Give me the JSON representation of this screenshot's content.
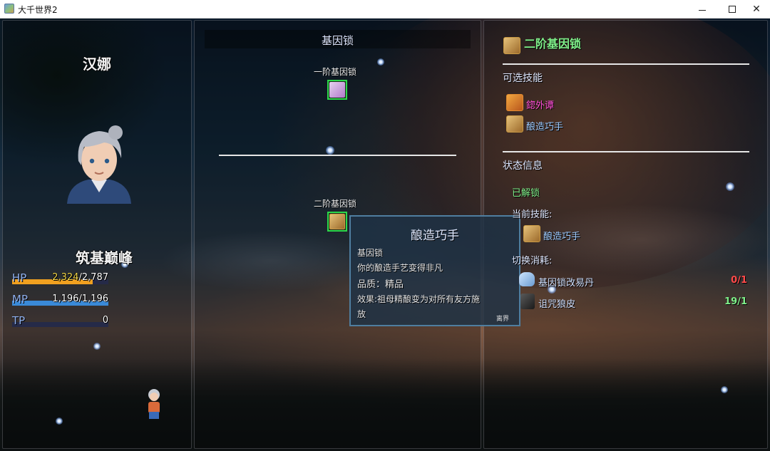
{
  "window": {
    "title": "大千世界2"
  },
  "character": {
    "name": "汉娜",
    "realm": "筑基巅峰",
    "stats": [
      {
        "label": "HP",
        "current": "2,324",
        "max": "2,787",
        "fraction": 0.834,
        "color": "#f0a020",
        "current_color": "low"
      },
      {
        "label": "MP",
        "current": "1,196",
        "max": "1,196",
        "fraction": 1.0,
        "color": "#3a8ad8",
        "current_color": "normal"
      },
      {
        "label": "TP",
        "value": "0",
        "fraction": 0.0,
        "color": "#3aa060"
      }
    ]
  },
  "gene_lock": {
    "title": "基因锁",
    "tiers": [
      {
        "label": "一阶基因锁",
        "icon": "tier1-gene-icon"
      },
      {
        "label": "二阶基因锁",
        "icon": "brewing-skill-icon"
      }
    ]
  },
  "tooltip": {
    "title": "酿造巧手",
    "category": "基因锁",
    "description": "你的酿造手艺变得非凡",
    "quality": "品质：精品",
    "effect_line1": "效果:祖母精酿变为对所有友方施",
    "effect_line2": "放",
    "close_label": "离界"
  },
  "detail": {
    "title": "二阶基因锁",
    "title_color": "#7ff08a",
    "skills_header": "可选技能",
    "skills": [
      {
        "name": "鍃外谭",
        "color": "#ff4fd8",
        "icon": "kick-skill-icon"
      },
      {
        "name": "酿造巧手",
        "color": "#9ecbff",
        "icon": "brewing-skill-icon"
      }
    ],
    "status_header": "状态信息",
    "unlocked_label": "已解锁",
    "current_skill_label": "当前技能:",
    "current_skill": "酿造巧手",
    "switch_cost_label": "切换消耗:",
    "costs": [
      {
        "name": "基因锁改易丹",
        "count": "0/1",
        "count_color": "#ff4a4a",
        "icon": "pill-item-icon"
      },
      {
        "name": "诅咒狼皮",
        "count": "19/1",
        "count_color": "#7ff08a",
        "icon": "wolf-pelt-item-icon"
      }
    ]
  }
}
